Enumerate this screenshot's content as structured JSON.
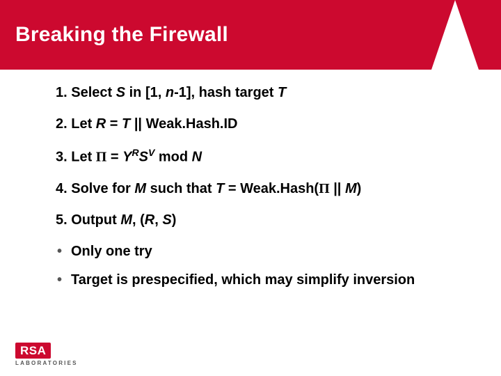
{
  "title": "Breaking the Firewall",
  "steps": {
    "s1_prefix": "1. Select ",
    "s1_S": "S",
    "s1_mid1": " in [1, ",
    "s1_n": "n",
    "s1_mid2": "-1], hash target ",
    "s1_T": "T",
    "s2_prefix": "2. Let ",
    "s2_R": "R",
    "s2_eq": " = ",
    "s2_T": "T",
    "s2_tail": " || Weak.Hash.ID",
    "s3_prefix": "3. Let ",
    "s3_Pi": "Π",
    "s3_eq": " = ",
    "s3_Y": "Y",
    "s3_supR": "R",
    "s3_S": "S",
    "s3_supV": "V",
    "s3_mod": " mod ",
    "s3_N": "N",
    "s4_prefix": "4. Solve for ",
    "s4_M": "M",
    "s4_mid1": " such that ",
    "s4_T": "T",
    "s4_mid2": " = Weak.Hash(",
    "s4_Pi": "Π",
    "s4_mid3": " || ",
    "s4_M2": "M",
    "s4_tail": ")",
    "s5_prefix": "5. Output ",
    "s5_M": "M",
    "s5_mid": ", (",
    "s5_R": "R",
    "s5_comma": ", ",
    "s5_S": "S",
    "s5_tail": ")"
  },
  "bullets": {
    "b1_pre": "Only ",
    "b1_one": "one",
    "b1_post": " try",
    "b2": "Target is prespecified, which may simplify inversion"
  },
  "logo": {
    "brand": "RSA",
    "sub": "LABORATORIES"
  }
}
